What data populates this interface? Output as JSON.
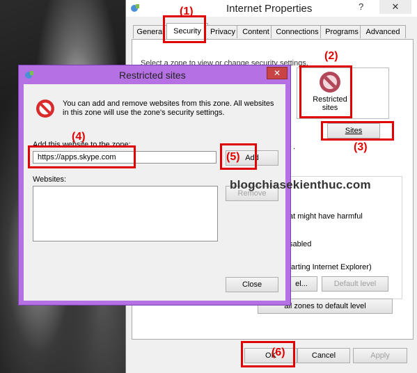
{
  "internet_properties": {
    "title": "Internet Properties",
    "help": "?",
    "close": "✕",
    "tabs": [
      "General",
      "Security",
      "Privacy",
      "Content",
      "Connections",
      "Programs",
      "Advanced"
    ],
    "zone_instruction": "Select a zone to view or change security settings.",
    "restricted_zone_label": "Restricted sites",
    "sites_button": "Sites",
    "partial_text_1": ".",
    "partial_text_2": "at might have harmful",
    "partial_text_3": "sabled",
    "partial_text_4": "tarting Internet Explorer)",
    "level_button": "el...",
    "default_level_button": "Default level",
    "reset_button": "all zones to default level",
    "ok_button": "OK",
    "cancel_button": "Cancel",
    "apply_button": "Apply"
  },
  "restricted_sites": {
    "title": "Restricted sites",
    "close": "✕",
    "info": "You can add and remove websites from this zone. All websites in this zone will use the zone's security settings.",
    "add_label": "Add this website to the zone:",
    "url_value": "https://apps.skype.com",
    "add_button": "Add",
    "websites_label": "Websites:",
    "remove_button": "Remove",
    "close_button": "Close"
  },
  "annotations": {
    "step1": "(1)",
    "step2": "(2)",
    "step3": "(3)",
    "step4": "(4)",
    "step5": "(5)",
    "step6": "(6)"
  },
  "watermark": "blogchiasekienthuc.com",
  "colors": {
    "annotation_red": "#e00000",
    "dialog_frame": "#b571e3"
  }
}
